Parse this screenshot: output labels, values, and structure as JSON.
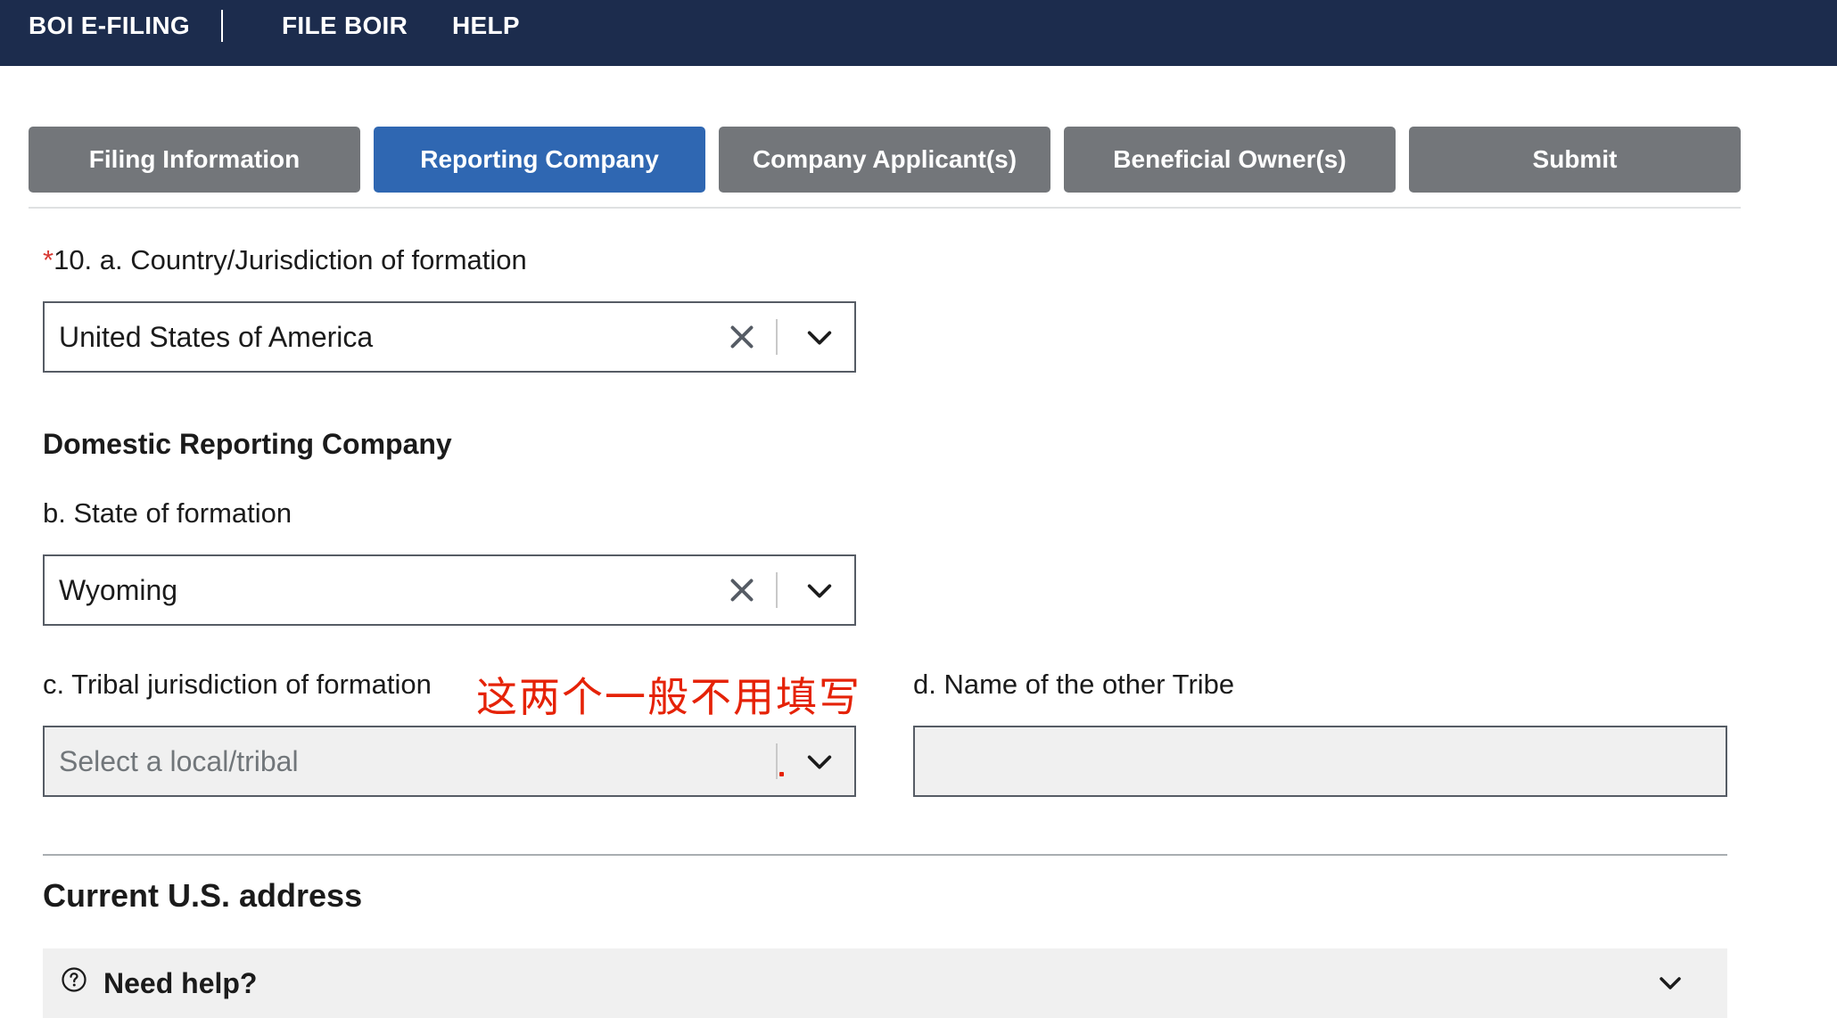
{
  "topnav": {
    "brand": "BOI E-FILING",
    "file_boir": "FILE BOIR",
    "help": "HELP"
  },
  "tabs": [
    {
      "label": "Filing Information",
      "active": false
    },
    {
      "label": "Reporting Company",
      "active": true
    },
    {
      "label": "Company Applicant(s)",
      "active": false
    },
    {
      "label": "Beneficial Owner(s)",
      "active": false
    },
    {
      "label": "Submit",
      "active": false
    }
  ],
  "form": {
    "country": {
      "required_mark": "*",
      "label": "10. a. Country/Jurisdiction of formation",
      "value": "United States of America"
    },
    "domestic_heading": "Domestic Reporting Company",
    "state": {
      "label": "b. State of formation",
      "value": "Wyoming"
    },
    "tribal": {
      "label": "c. Tribal jurisdiction of formation",
      "placeholder": "Select a local/tribal"
    },
    "other_tribe": {
      "label": "d. Name of the other Tribe",
      "value": ""
    },
    "annotation": "这两个一般不用填写",
    "address_heading": "Current U.S. address",
    "need_help": "Need help?"
  },
  "colors": {
    "topbar": "#1c2c4d",
    "tab_active": "#2f67b2",
    "tab_inactive": "#73767a",
    "required": "#d83933",
    "annotation": "#e52207"
  },
  "icons": {
    "clear": "close-icon",
    "dropdown": "chevron-down-icon",
    "help": "question-circle-icon"
  }
}
